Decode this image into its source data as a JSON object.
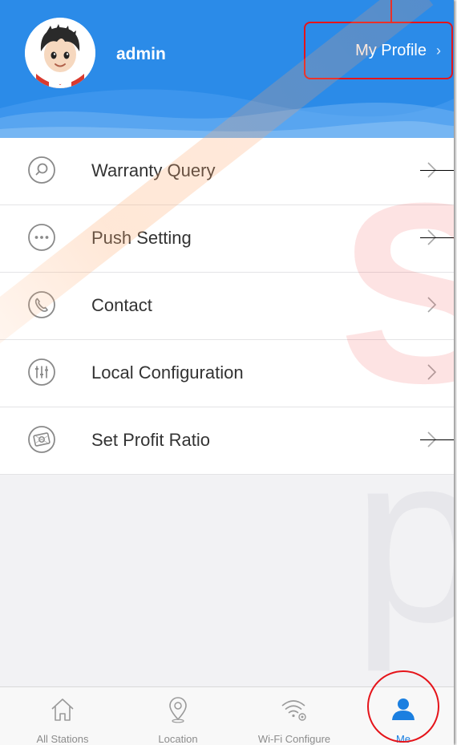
{
  "header": {
    "username": "admin",
    "profile_label": "My Profile",
    "profile_chevron": "›",
    "background_color": "#2b8be8",
    "avatar_icon": "cartoon-boy-avatar"
  },
  "menu": {
    "items": [
      {
        "label": "Warranty Query",
        "icon": "search-circle-icon"
      },
      {
        "label": "Push Setting",
        "icon": "ellipsis-circle-icon"
      },
      {
        "label": "Contact",
        "icon": "phone-circle-icon"
      },
      {
        "label": "Local Configuration",
        "icon": "sliders-circle-icon"
      },
      {
        "label": "Set Profit Ratio",
        "icon": "money-circle-icon"
      }
    ]
  },
  "tabbar": {
    "tabs": [
      {
        "label": "All Stations",
        "icon": "home-icon",
        "active": false
      },
      {
        "label": "Location",
        "icon": "location-pin-icon",
        "active": false
      },
      {
        "label": "Wi-Fi Configure",
        "icon": "wifi-gear-icon",
        "active": false
      },
      {
        "label": "Me",
        "icon": "person-icon",
        "active": true
      }
    ],
    "active_color": "#1b7fe0",
    "inactive_color": "#8c8c8c"
  },
  "annotation_color": "#e5141a"
}
